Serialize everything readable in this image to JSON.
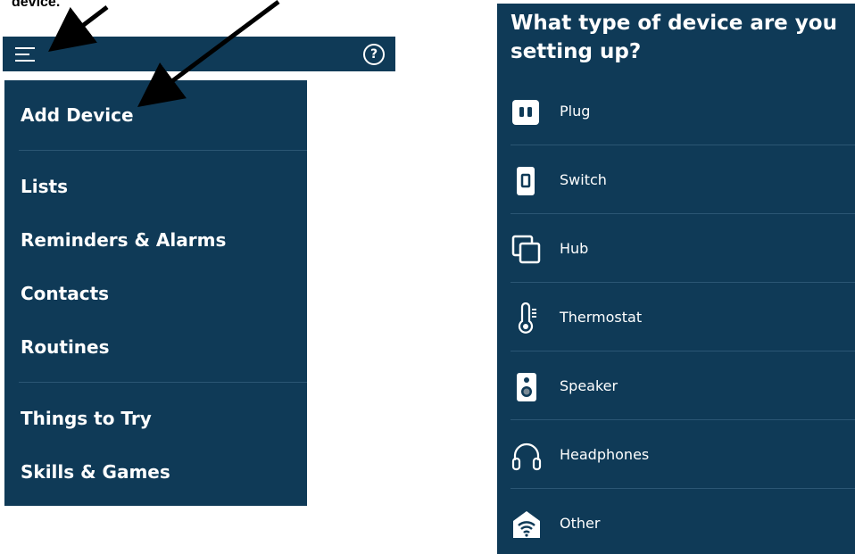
{
  "caption": "device.",
  "topbar": {
    "help_glyph": "?"
  },
  "menu": {
    "items": [
      {
        "label": "Add Device"
      },
      {
        "label": "Lists"
      },
      {
        "label": "Reminders & Alarms"
      },
      {
        "label": "Contacts"
      },
      {
        "label": "Routines"
      },
      {
        "label": "Things to Try"
      },
      {
        "label": "Skills & Games"
      }
    ]
  },
  "device_panel": {
    "title": "What type of device are you setting up?",
    "items": [
      {
        "label": "Plug",
        "icon": "plug-icon"
      },
      {
        "label": "Switch",
        "icon": "switch-icon"
      },
      {
        "label": "Hub",
        "icon": "hub-icon"
      },
      {
        "label": "Thermostat",
        "icon": "thermostat-icon"
      },
      {
        "label": "Speaker",
        "icon": "speaker-icon"
      },
      {
        "label": "Headphones",
        "icon": "headphones-icon"
      },
      {
        "label": "Other",
        "icon": "wifi-home-icon"
      }
    ]
  },
  "colors": {
    "panel_bg": "#0f3a57",
    "divider": "#2b5674",
    "text": "#ffffff"
  }
}
